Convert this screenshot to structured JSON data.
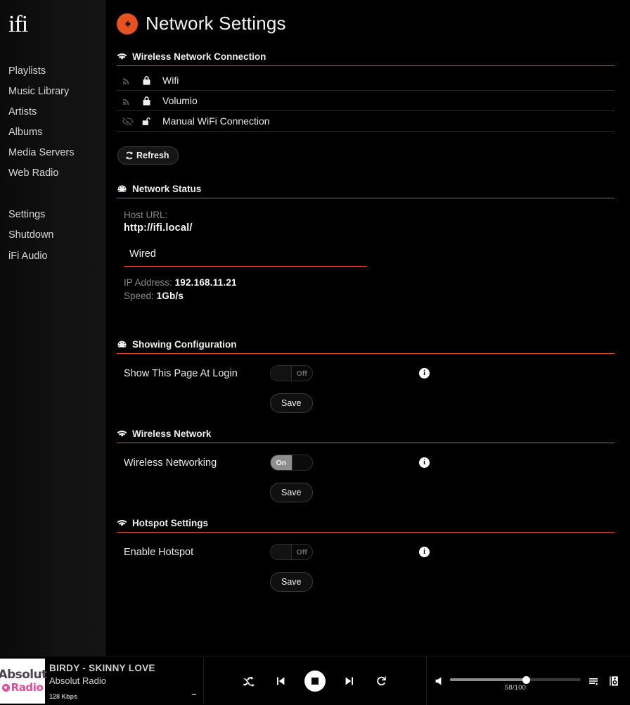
{
  "brand": {
    "logo_text": "ifi",
    "accent": "#e8521f"
  },
  "sidebar": {
    "group1": [
      {
        "label": "Playlists"
      },
      {
        "label": "Music Library"
      },
      {
        "label": "Artists"
      },
      {
        "label": "Albums"
      },
      {
        "label": "Media Servers"
      },
      {
        "label": "Web Radio"
      }
    ],
    "group2": [
      {
        "label": "Settings"
      },
      {
        "label": "Shutdown"
      },
      {
        "label": "iFi Audio"
      }
    ]
  },
  "header": {
    "title": "Network Settings",
    "back_icon": "arrow-left-icon"
  },
  "wireless_connection": {
    "title": "Wireless Network Connection",
    "icon": "wifi-icon",
    "networks": [
      {
        "name": "Wifi",
        "signal_icon": "signal-icon",
        "lock_icon": "lock-closed-icon"
      },
      {
        "name": "Volumio",
        "signal_icon": "signal-icon",
        "lock_icon": "lock-closed-icon"
      },
      {
        "name": "Manual WiFi Connection",
        "signal_icon": "eye-slash-icon",
        "lock_icon": "lock-open-icon"
      }
    ],
    "refresh_label": "Refresh",
    "refresh_icon": "refresh-icon"
  },
  "network_status": {
    "title": "Network Status",
    "icon": "dashboard-icon",
    "host_url_label": "Host URL:",
    "host_url_value": "http://ifi.local/",
    "tab_label": "Wired",
    "ip_label": "IP Address:",
    "ip_value": "192.168.11.21",
    "speed_label": "Speed:",
    "speed_value": "1Gb/s"
  },
  "showing_configuration": {
    "title": "Showing Configuration",
    "icon": "dashboard-icon",
    "row_label": "Show This Page At Login",
    "toggle_state": "off",
    "toggle_text": "Off",
    "info_icon": "info-icon",
    "save_label": "Save"
  },
  "wireless_network": {
    "title": "Wireless Network",
    "icon": "wifi-icon",
    "row_label": "Wireless Networking",
    "toggle_state": "on",
    "toggle_text": "On",
    "info_icon": "info-icon",
    "save_label": "Save"
  },
  "hotspot_settings": {
    "title": "Hotspot Settings",
    "icon": "wifi-icon",
    "row_label": "Enable Hotspot",
    "toggle_state": "off",
    "toggle_text": "Off",
    "info_icon": "info-icon",
    "save_label": "Save"
  },
  "player": {
    "art_line1": "Absolut",
    "art_line2": "Radio",
    "title": "BIRDY - SKINNY LOVE",
    "subtitle": "Absolut Radio",
    "bitrate": "128 Kbps",
    "more_label": "...",
    "controls": {
      "shuffle_icon": "shuffle-icon",
      "prev_icon": "previous-icon",
      "stop_icon": "stop-icon",
      "next_icon": "next-icon",
      "repeat_icon": "repeat-icon"
    },
    "volume": {
      "speaker_icon": "speaker-icon",
      "value_text": "58/100",
      "value": 58,
      "max": 100,
      "queue_icon": "queue-list-icon",
      "output_icon": "audio-output-icon"
    }
  }
}
